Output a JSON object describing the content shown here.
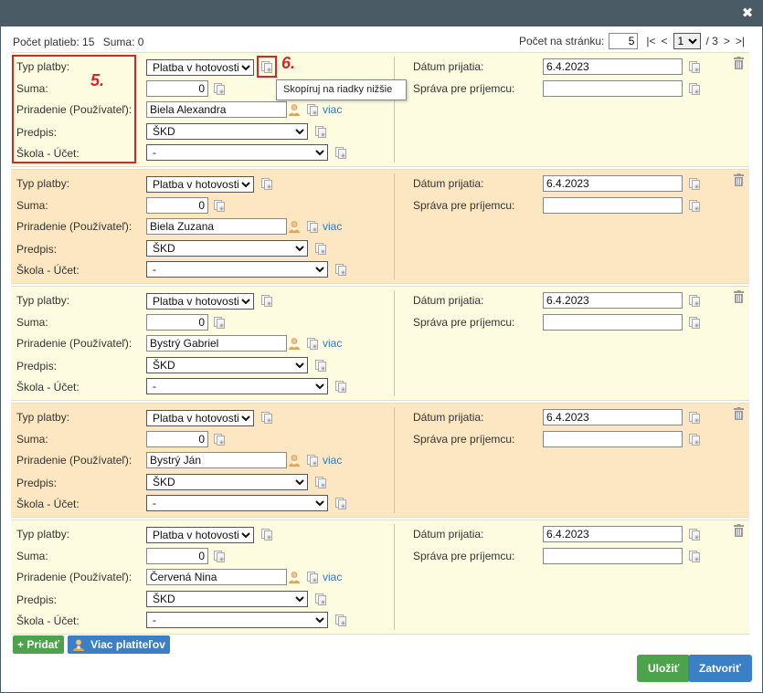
{
  "summary": {
    "count_label": "Počet platieb: 15",
    "sum_label": "Suma: 0"
  },
  "pager": {
    "per_page_label": "Počet na stránku:",
    "per_page_value": "5",
    "first": "|<",
    "prev": "<",
    "current_page": "1",
    "total": "/ 3",
    "next": ">",
    "last": ">|"
  },
  "labels": {
    "type": "Typ platby:",
    "amount": "Suma:",
    "assign": "Priradenie (Používateľ):",
    "prescription": "Predpis:",
    "school": "Škola - Účet:",
    "date": "Dátum prijatia:",
    "message": "Správa pre príjemcu:",
    "more": "viac"
  },
  "payments": [
    {
      "type": "Platba v hotovosti",
      "amount": "0",
      "user": "Biela Alexandra",
      "prescription": "ŠKD",
      "school": "-",
      "date": "6.4.2023",
      "message": ""
    },
    {
      "type": "Platba v hotovosti",
      "amount": "0",
      "user": "Biela Zuzana",
      "prescription": "ŠKD",
      "school": "-",
      "date": "6.4.2023",
      "message": ""
    },
    {
      "type": "Platba v hotovosti",
      "amount": "0",
      "user": "Bystrý Gabriel",
      "prescription": "ŠKD",
      "school": "-",
      "date": "6.4.2023",
      "message": ""
    },
    {
      "type": "Platba v hotovosti",
      "amount": "0",
      "user": "Bystrý Ján",
      "prescription": "ŠKD",
      "school": "-",
      "date": "6.4.2023",
      "message": ""
    },
    {
      "type": "Platba v hotovosti",
      "amount": "0",
      "user": "Červená Nina",
      "prescription": "ŠKD",
      "school": "-",
      "date": "6.4.2023",
      "message": ""
    }
  ],
  "annotations": {
    "box5": "5.",
    "box6": "6."
  },
  "tooltip": "Skopíruj na riadky nižšie",
  "buttons": {
    "add": "+ Pridať",
    "more_payers": "Viac platiteľov",
    "save": "Uložiť",
    "close": "Zatvoriť"
  },
  "colors": {
    "titlebar": "#4b5b66",
    "row_odd": "#fdfce0",
    "row_even": "#fde7c3",
    "annotation_red": "#d9242b",
    "green_button": "#4ca34c",
    "blue_button": "#3b7fc4",
    "link": "#2a78c7"
  }
}
